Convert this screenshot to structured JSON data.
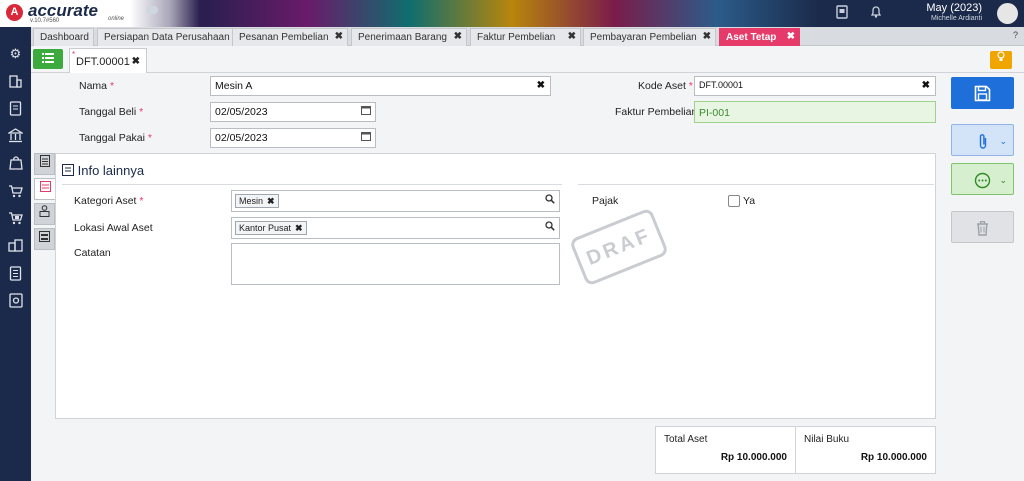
{
  "app": {
    "logo_mark": "A",
    "name": "accurate",
    "version": "v.10.7#560",
    "edition": "online",
    "period": "May (2023)",
    "user": "Michelle Ardianti"
  },
  "tabs": [
    {
      "label": "Dashboard",
      "closable": false
    },
    {
      "label": "Persiapan Data Perusahaan",
      "closable": false
    },
    {
      "label": "Pesanan Pembelian",
      "closable": true
    },
    {
      "label": "Penerimaan Barang",
      "closable": true
    },
    {
      "label": "Faktur Pembelian",
      "closable": true
    },
    {
      "label": "Pembayaran Pembelian",
      "closable": true
    },
    {
      "label": "Aset Tetap",
      "closable": true,
      "active": true
    }
  ],
  "tab_help": "?",
  "close_glyph": "✖",
  "doc_tab": {
    "label": "DFT.00001"
  },
  "form": {
    "nama": {
      "label": "Nama",
      "value": "Mesin A"
    },
    "tanggal_beli": {
      "label": "Tanggal Beli",
      "value": "02/05/2023"
    },
    "tanggal_pakai": {
      "label": "Tanggal Pakai",
      "value": "02/05/2023"
    },
    "kode_aset": {
      "label": "Kode Aset",
      "value": "DFT.00001"
    },
    "faktur_pembelian": {
      "label": "Faktur Pembelian",
      "value": "PI-001"
    },
    "required_mark": "*"
  },
  "info": {
    "title": "Info lainnya",
    "kategori_aset": {
      "label": "Kategori Aset",
      "chip": "Mesin"
    },
    "lokasi_awal": {
      "label": "Lokasi Awal Aset",
      "chip": "Kantor Pusat"
    },
    "catatan": {
      "label": "Catatan",
      "value": ""
    },
    "pajak": {
      "label": "Pajak",
      "option": "Ya",
      "checked": false
    },
    "stamp": "DRAF"
  },
  "summary": {
    "total_aset": {
      "label": "Total Aset",
      "value": "Rp 10.000.000"
    },
    "nilai_buku": {
      "label": "Nilai Buku",
      "value": "Rp 10.000.000"
    }
  },
  "colors": {
    "accent": "#e63a6b",
    "sidebar": "#1b2a4a",
    "save": "#1e6fd9",
    "success": "#3caa3c",
    "warning": "#f0a500"
  },
  "icons": {
    "sidebar": [
      "settings-icon",
      "company-icon",
      "ledger-icon",
      "bank-icon",
      "sales-bag-icon",
      "cart-icon",
      "shipping-cart-icon",
      "warehouse-icon",
      "report-icon",
      "dashboard-settings-icon"
    ]
  }
}
